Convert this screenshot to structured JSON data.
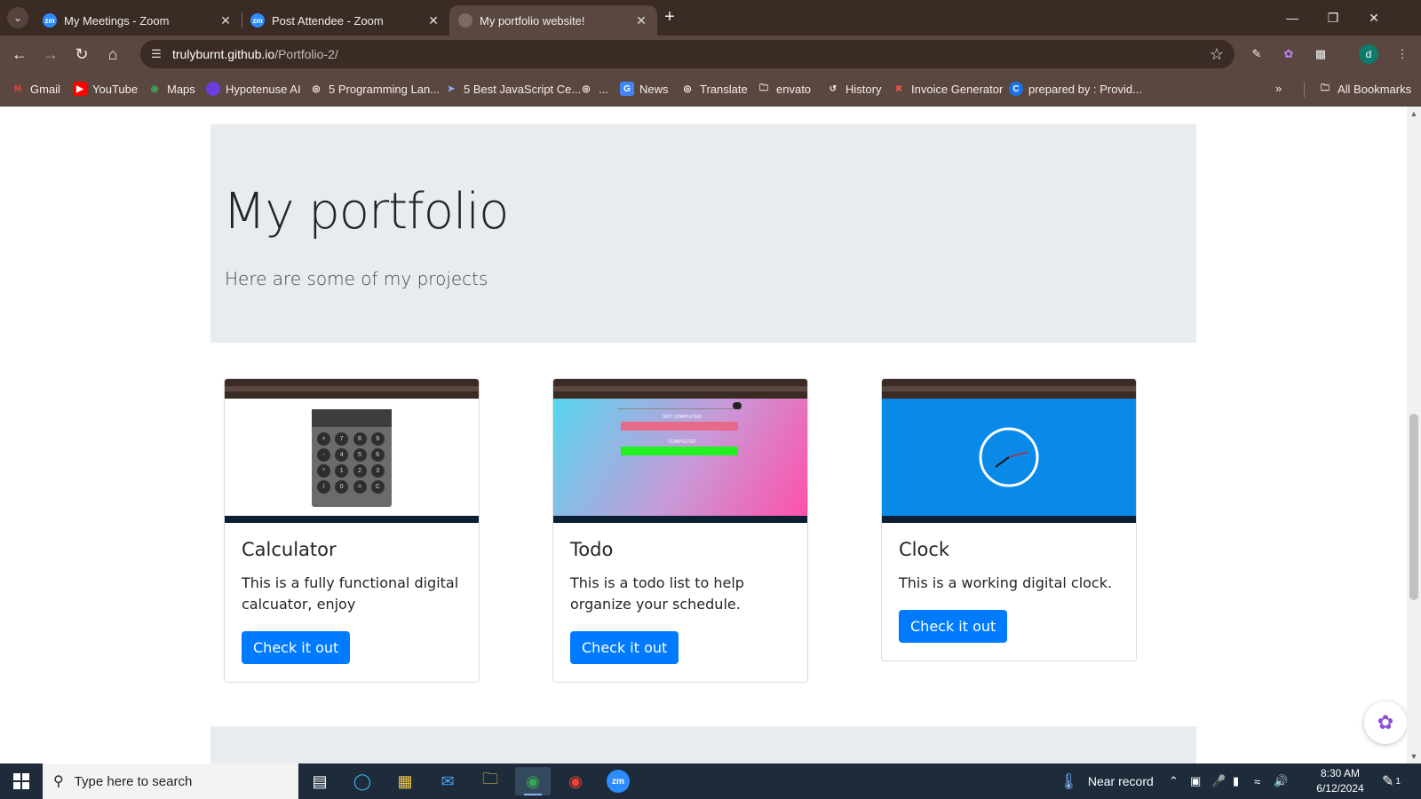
{
  "browser": {
    "tabs": [
      {
        "title": "My Meetings - Zoom",
        "favicon": "zm"
      },
      {
        "title": "Post Attendee - Zoom",
        "favicon": "zm"
      },
      {
        "title": "My portfolio website!",
        "favicon": ""
      }
    ],
    "new_tab": "+",
    "url_host": "trulyburnt.github.io",
    "url_path": "/Portfolio-2/",
    "profile_initial": "d",
    "bookmarks": [
      {
        "label": "Gmail",
        "icon": "gmail-icon",
        "color": "#ea4335"
      },
      {
        "label": "YouTube",
        "icon": "youtube-icon",
        "color": "#ff0000"
      },
      {
        "label": "Maps",
        "icon": "maps-icon",
        "color": "#34a853"
      },
      {
        "label": "Hypotenuse AI",
        "icon": "hypotenuse-icon",
        "color": "#6c3ce0"
      },
      {
        "label": "5 Programming Lan...",
        "icon": "globe-icon",
        "color": "#777777"
      },
      {
        "label": "5 Best JavaScript Ce...",
        "icon": "js-icon",
        "color": "#2b6cb0"
      },
      {
        "label": "...",
        "icon": "globe-icon",
        "color": "#777777"
      },
      {
        "label": "News",
        "icon": "news-icon",
        "color": "#4285f4"
      },
      {
        "label": "Translate",
        "icon": "globe-icon",
        "color": "#777777"
      },
      {
        "label": "envato",
        "icon": "folder-icon",
        "color": "#5a4740"
      },
      {
        "label": "History",
        "icon": "history-icon",
        "color": "#5a4740"
      },
      {
        "label": "Invoice Generator",
        "icon": "invoice-icon",
        "color": "#e05a3a"
      },
      {
        "label": "prepared by : Provid...",
        "icon": "c-icon",
        "color": "#1a73e8"
      }
    ],
    "all_bookmarks": "All Bookmarks"
  },
  "page": {
    "title": "My portfolio",
    "subtitle": "Here are some of my projects",
    "cards": [
      {
        "title": "Calculator",
        "text": "This is a fully functional digital calcuator, enjoy",
        "button": "Check it out"
      },
      {
        "title": "Todo",
        "text": "This is a todo list to help organize your schedule.",
        "button": "Check it out"
      },
      {
        "title": "Clock",
        "text": "This is a working digital clock.",
        "button": "Check it out"
      }
    ],
    "calculator_keys": [
      "+",
      "7",
      "8",
      "9",
      "-",
      "4",
      "5",
      "6",
      "*",
      "1",
      "2",
      "3",
      "/",
      "0",
      "=",
      "C"
    ],
    "todo_labels": {
      "not_completed": "NOT COMPLETED",
      "completed": "COMPLETED"
    }
  },
  "taskbar": {
    "search_placeholder": "Type here to search",
    "weather": "Near record",
    "time": "8:30 AM",
    "date": "6/12/2024",
    "notifications": "1"
  },
  "colors": {
    "accent": "#007bff",
    "jumbotron": "#e9ecef",
    "browser_frame": "#3b2b25",
    "browser_toolbar": "#5a4740",
    "clock_bg": "#0a8ae8"
  }
}
